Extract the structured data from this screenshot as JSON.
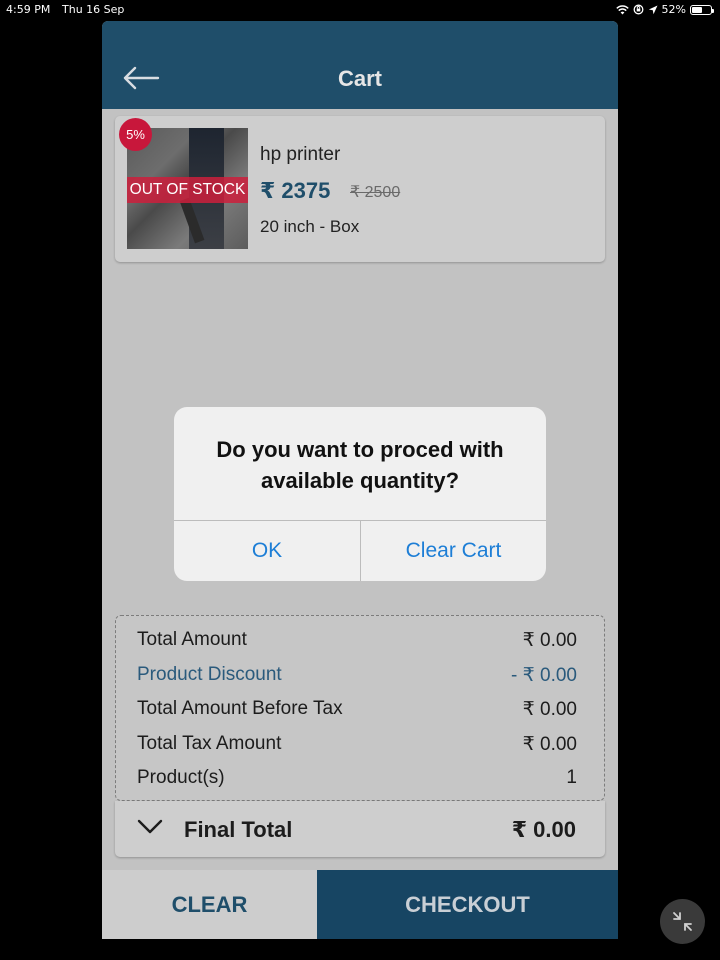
{
  "status_bar": {
    "time": "4:59 PM",
    "date": "Thu 16 Sep",
    "battery": "52%",
    "battery_level": 0.52
  },
  "header": {
    "title": "Cart",
    "back_icon": "arrow-left-icon"
  },
  "cart_item": {
    "discount_badge": "5%",
    "stock_label": "OUT OF STOCK",
    "name": "hp printer",
    "price": "₹ 2375",
    "mrp": "₹ 2500",
    "variant": "20 inch - Box"
  },
  "summary": {
    "rows": [
      {
        "label": "Total Amount",
        "value": "₹ 0.00"
      },
      {
        "label": "Product Discount",
        "value": "- ₹ 0.00"
      },
      {
        "label": "Total Amount Before Tax",
        "value": "₹ 0.00"
      },
      {
        "label": "Total Tax Amount",
        "value": "₹ 0.00"
      },
      {
        "label": "Product(s)",
        "value": "1"
      }
    ],
    "final_label": "Final Total",
    "final_value": "₹ 0.00"
  },
  "footer": {
    "clear_label": "CLEAR",
    "checkout_label": "CHECKOUT"
  },
  "alert": {
    "message": "Do you want to proced with available quantity?",
    "ok_label": "OK",
    "clear_cart_label": "Clear Cart"
  },
  "colors": {
    "primary": "#1f4e6a",
    "accent_badge": "#c8173b",
    "alert_button": "#1d7ed6"
  }
}
